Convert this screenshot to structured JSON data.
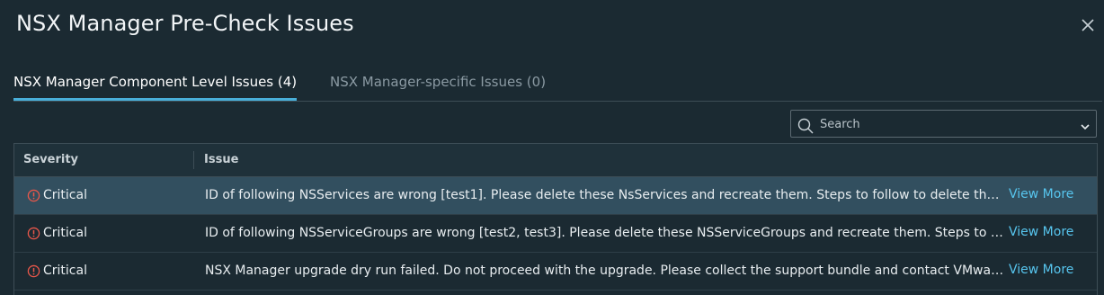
{
  "dialog": {
    "title": "NSX Manager Pre-Check Issues",
    "close_icon": "close-icon"
  },
  "tabs": [
    {
      "label": "NSX Manager Component Level Issues (4)",
      "active": true
    },
    {
      "label": "NSX Manager-specific Issues (0)",
      "active": false
    }
  ],
  "search": {
    "placeholder": "Search",
    "value": "",
    "icon": "search-icon",
    "dropdown_icon": "chevron-down-icon"
  },
  "grid": {
    "columns": [
      "Severity",
      "Issue"
    ],
    "rows": [
      {
        "severity": "Critical",
        "severity_icon": "exclamation-circle-icon",
        "issue": "ID of following NSServices are wrong [test1]. Please delete these NsServices and recreate them. Steps to follow to delete these NsServices",
        "link": "View More",
        "selected": true
      },
      {
        "severity": "Critical",
        "severity_icon": "exclamation-circle-icon",
        "issue": "ID of following NSServiceGroups are wrong [test2, test3]. Please delete these NSServiceGroups and recreate them. Steps to follow",
        "link": "View More",
        "selected": false
      },
      {
        "severity": "Critical",
        "severity_icon": "exclamation-circle-icon",
        "issue": "NSX Manager upgrade dry run failed. Do not proceed with the upgrade. Please collect the support bundle and contact VMware support",
        "link": "View More",
        "selected": false
      }
    ]
  },
  "colors": {
    "background": "#1b2a32",
    "accent": "#49afd9",
    "link": "#57c5ee",
    "critical": "#e9574a",
    "selected_row": "#324f5f"
  }
}
